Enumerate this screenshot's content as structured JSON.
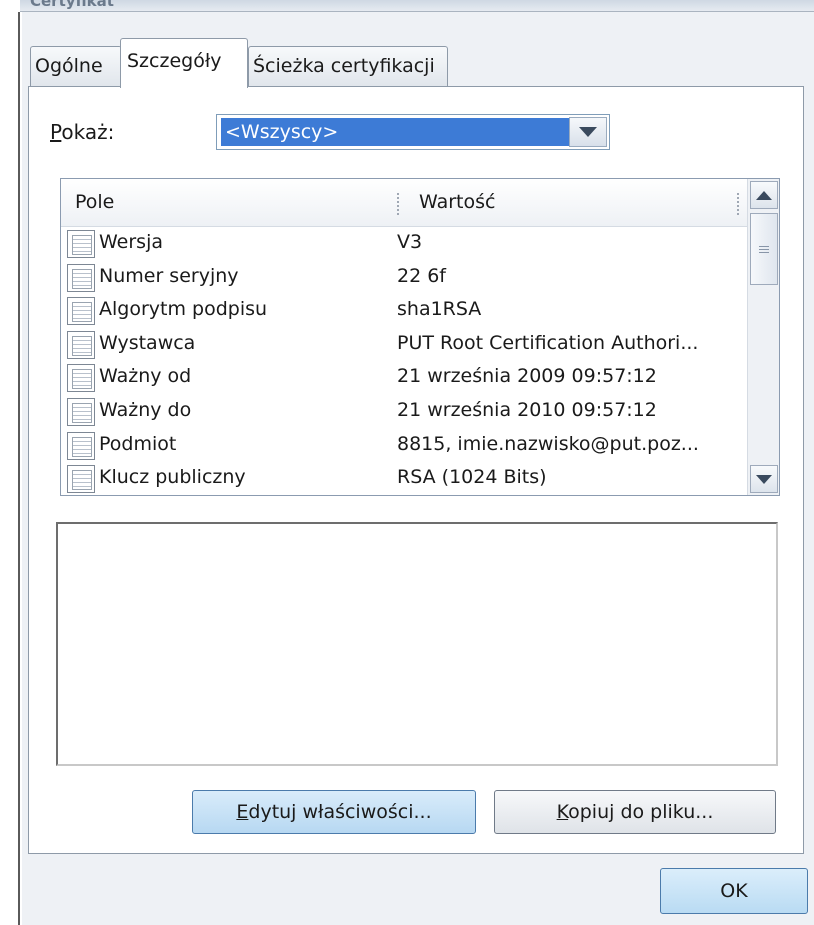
{
  "window": {
    "title": "Certyfikat"
  },
  "tabs": [
    {
      "label": "Ogólne",
      "active": false
    },
    {
      "label": "Szczegóły",
      "active": true
    },
    {
      "label": "Ścieżka certyfikacji",
      "active": false
    }
  ],
  "show": {
    "label_accel": "P",
    "label_rest": "okaż:",
    "selected": "<Wszyscy>"
  },
  "list": {
    "columns": [
      "Pole",
      "Wartość"
    ],
    "rows": [
      {
        "field": "Wersja",
        "value": "V3"
      },
      {
        "field": "Numer seryjny",
        "value": "22 6f"
      },
      {
        "field": "Algorytm podpisu",
        "value": "sha1RSA"
      },
      {
        "field": "Wystawca",
        "value": "PUT Root Certification Authori..."
      },
      {
        "field": "Ważny od",
        "value": "21 września 2009 09:57:12"
      },
      {
        "field": "Ważny do",
        "value": "21 września 2010 09:57:12"
      },
      {
        "field": "Podmiot",
        "value": "8815, imie.nazwisko@put.poz..."
      },
      {
        "field": "Klucz publiczny",
        "value": "RSA (1024 Bits)"
      }
    ]
  },
  "detail": {
    "text": ""
  },
  "buttons": {
    "edit_accel": "E",
    "edit_rest": "dytuj właściwości...",
    "copy_accel": "K",
    "copy_rest": "opiuj do pliku...",
    "ok": "OK"
  },
  "icons": {
    "field_icon": "certificate-field-icon",
    "dropdown_icon": "chevron-down-icon",
    "scroll_up_icon": "scroll-up-icon",
    "scroll_down_icon": "scroll-down-icon"
  },
  "colors": {
    "selection": "#3d7bd6",
    "dialog_bg": "#eef1f5",
    "border": "#8e9aa8"
  }
}
